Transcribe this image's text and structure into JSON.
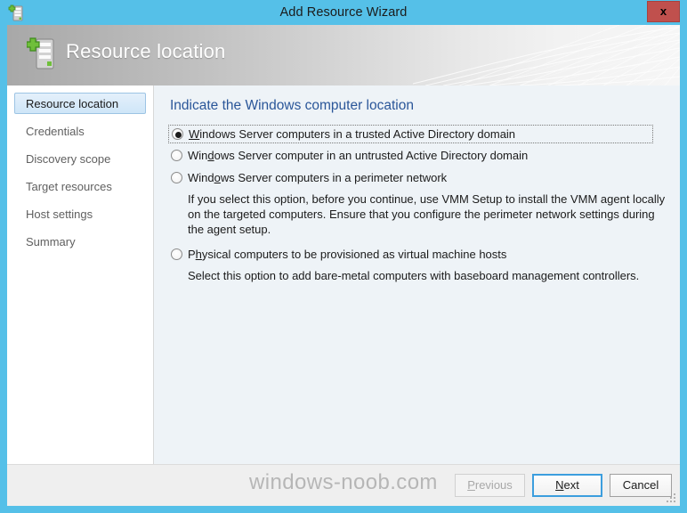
{
  "window": {
    "title": "Add Resource Wizard",
    "titlebar_icon": "server-add-icon",
    "close_label": "x",
    "accent_color": "#55c0e8",
    "close_button_color": "#c0504d"
  },
  "banner": {
    "title": "Resource location",
    "icon": "server-add-icon"
  },
  "sidebar": {
    "items": [
      {
        "label": "Resource location",
        "selected": true
      },
      {
        "label": "Credentials",
        "selected": false
      },
      {
        "label": "Discovery scope",
        "selected": false
      },
      {
        "label": "Target resources",
        "selected": false
      },
      {
        "label": "Host settings",
        "selected": false
      },
      {
        "label": "Summary",
        "selected": false
      }
    ]
  },
  "content": {
    "heading": "Indicate the Windows computer location",
    "heading_color": "#2a5699",
    "options": [
      {
        "label": "Windows Server computers in a trusted Active Directory domain",
        "accel_before": "",
        "accel": "W",
        "accel_after": "indows Server computers in a trusted Active Directory domain",
        "checked": true,
        "focused": true,
        "description": ""
      },
      {
        "label": "Windows Server computer in an untrusted Active Directory domain",
        "accel_before": "Win",
        "accel": "d",
        "accel_after": "ows Server computer in an untrusted Active Directory domain",
        "checked": false,
        "focused": false,
        "description": ""
      },
      {
        "label": "Windows Server computers in a perimeter network",
        "accel_before": "Wind",
        "accel": "o",
        "accel_after": "ws Server computers in a perimeter network",
        "checked": false,
        "focused": false,
        "description": "If you select this option, before you continue, use VMM Setup to install the VMM agent locally on the targeted computers. Ensure that you configure the perimeter network settings during the agent setup."
      },
      {
        "label": "Physical computers to be provisioned as virtual machine hosts",
        "accel_before": "P",
        "accel": "h",
        "accel_after": "ysical computers to be provisioned as virtual machine hosts",
        "checked": false,
        "focused": false,
        "description": "Select this option to add bare-metal computers with baseboard management controllers."
      }
    ]
  },
  "footer": {
    "watermark": "windows-noob.com",
    "buttons": {
      "previous": {
        "before": "",
        "accel": "P",
        "after": "revious",
        "enabled": false
      },
      "next": {
        "before": "",
        "accel": "N",
        "after": "ext",
        "enabled": true,
        "focused": true
      },
      "cancel": {
        "before": "Cancel",
        "accel": "",
        "after": "",
        "enabled": true
      }
    },
    "resize_grip": "resize-grip-icon"
  }
}
